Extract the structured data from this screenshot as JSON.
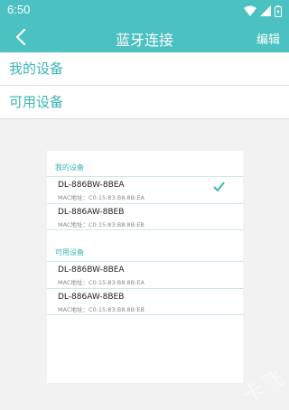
{
  "status": {
    "time": "6:50"
  },
  "header": {
    "title": "蓝牙连接",
    "edit_label": "编辑"
  },
  "sections": {
    "my_devices": "我的设备",
    "available_devices": "可用设备"
  },
  "card": {
    "my_devices_label": "我的设备",
    "available_label": "可用设备",
    "my_devices": [
      {
        "name": "DL-886BW-8BEA",
        "mac": "MAC地址：C0:15:83:B8:8B:EA",
        "selected": true
      },
      {
        "name": "DL-886AW-8BEB",
        "mac": "MAC地址：C0:15:83:B8:8B:EB",
        "selected": false
      }
    ],
    "available_devices": [
      {
        "name": "DL-886BW-8BEA",
        "mac": "MAC地址：C0:15:83:B8:8B:EA"
      },
      {
        "name": "DL-886AW-8BEB",
        "mac": "MAC地址：C0:15:83:B8:8B:EB"
      }
    ]
  },
  "watermark": "卡飞",
  "colors": {
    "accent": "#4cc1c1",
    "accent_text": "#3cb6b6"
  }
}
